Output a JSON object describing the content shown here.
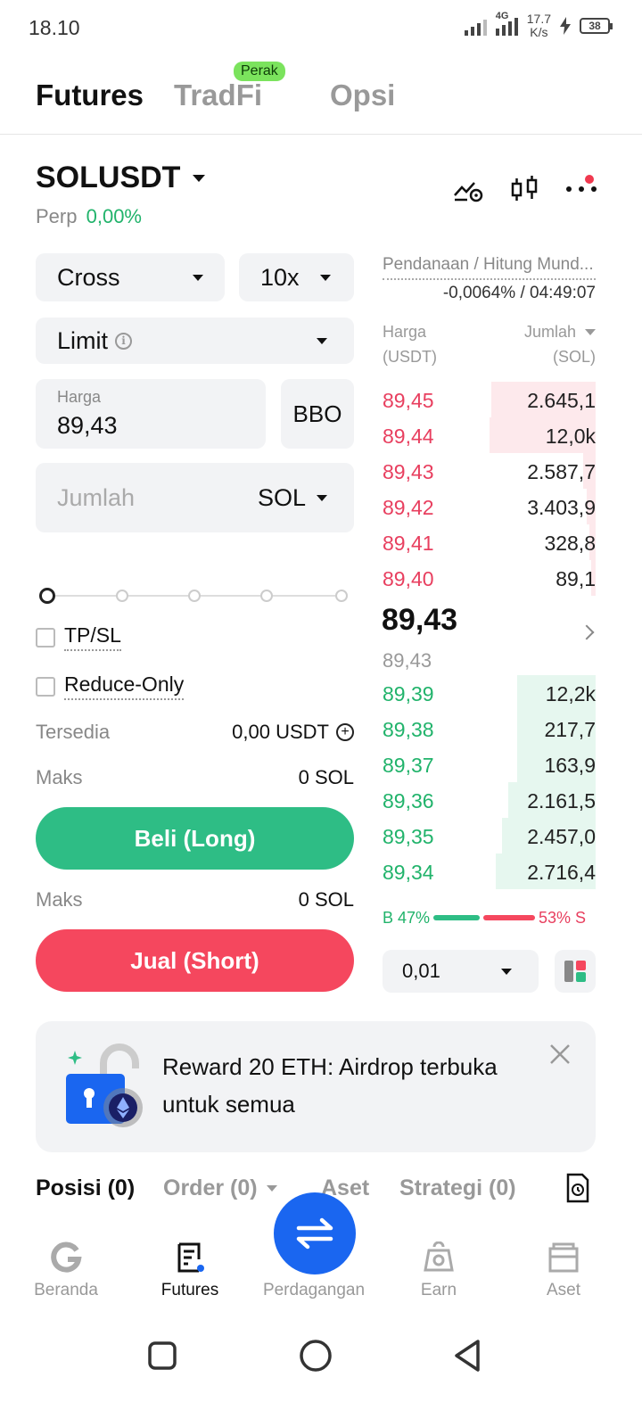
{
  "status_bar": {
    "time": "18.10",
    "network": "4G",
    "speed_value": "17.7",
    "speed_unit": "K/s",
    "battery": "38"
  },
  "top_tabs": {
    "futures": "Futures",
    "tradfi": "TradFi",
    "tradfi_badge": "Perak",
    "options": "Opsi"
  },
  "pair": {
    "name": "SOLUSDT",
    "type": "Perp",
    "change": "0,00%"
  },
  "form": {
    "margin_mode": "Cross",
    "leverage": "10x",
    "order_type": "Limit",
    "price_label": "Harga",
    "price_value": "89,43",
    "bbo_label": "BBO",
    "quantity_placeholder": "Jumlah",
    "quantity_unit": "SOL",
    "slider_value": 0,
    "tpsl_label": "TP/SL",
    "reduce_only_label": "Reduce-Only",
    "available_label": "Tersedia",
    "available_value": "0,00 USDT",
    "max_long_label": "Maks",
    "max_long_value": "0 SOL",
    "buy_label": "Beli (Long)",
    "max_short_label": "Maks",
    "max_short_value": "0 SOL",
    "sell_label": "Jual (Short)"
  },
  "orderbook": {
    "funding_label": "Pendanaan / Hitung Mund...",
    "funding_value": "-0,0064% / 04:49:07",
    "price_header": "Harga",
    "price_unit": "(USDT)",
    "amount_header": "Jumlah",
    "amount_unit": "(SOL)",
    "asks": [
      {
        "price": "89,45",
        "amount": "2.645,1",
        "depth": 0.49
      },
      {
        "price": "89,44",
        "amount": "12,0k",
        "depth": 0.5
      },
      {
        "price": "89,43",
        "amount": "2.587,7",
        "depth": 0.06
      },
      {
        "price": "89,42",
        "amount": "3.403,9",
        "depth": 0.04
      },
      {
        "price": "89,41",
        "amount": "328,8",
        "depth": 0.03
      },
      {
        "price": "89,40",
        "amount": "89,1",
        "depth": 0.02
      }
    ],
    "last_price": "89,43",
    "mark_price": "89,43",
    "bids": [
      {
        "price": "89,39",
        "amount": "12,2k",
        "depth": 0.37
      },
      {
        "price": "89,38",
        "amount": "217,7",
        "depth": 0.37
      },
      {
        "price": "89,37",
        "amount": "163,9",
        "depth": 0.37
      },
      {
        "price": "89,36",
        "amount": "2.161,5",
        "depth": 0.41
      },
      {
        "price": "89,35",
        "amount": "2.457,0",
        "depth": 0.44
      },
      {
        "price": "89,34",
        "amount": "2.716,4",
        "depth": 0.47
      }
    ],
    "buy_ratio": "B 47%",
    "sell_ratio": "53% S",
    "buy_ratio_value": 47,
    "sell_ratio_value": 53,
    "precision": "0,01"
  },
  "banner": {
    "text": "Reward 20 ETH: Airdrop terbuka untuk semua"
  },
  "bottom_tabs": {
    "positions": "Posisi (0)",
    "orders": "Order (0)",
    "assets": "Aset",
    "strategies": "Strategi (0)"
  },
  "nav": {
    "home": "Beranda",
    "futures": "Futures",
    "trade": "Perdagangan",
    "earn": "Earn",
    "assets": "Aset"
  },
  "colors": {
    "green": "#2ebd85",
    "red": "#f5475e",
    "blue": "#1a66f0",
    "badge": "#7be35d"
  }
}
